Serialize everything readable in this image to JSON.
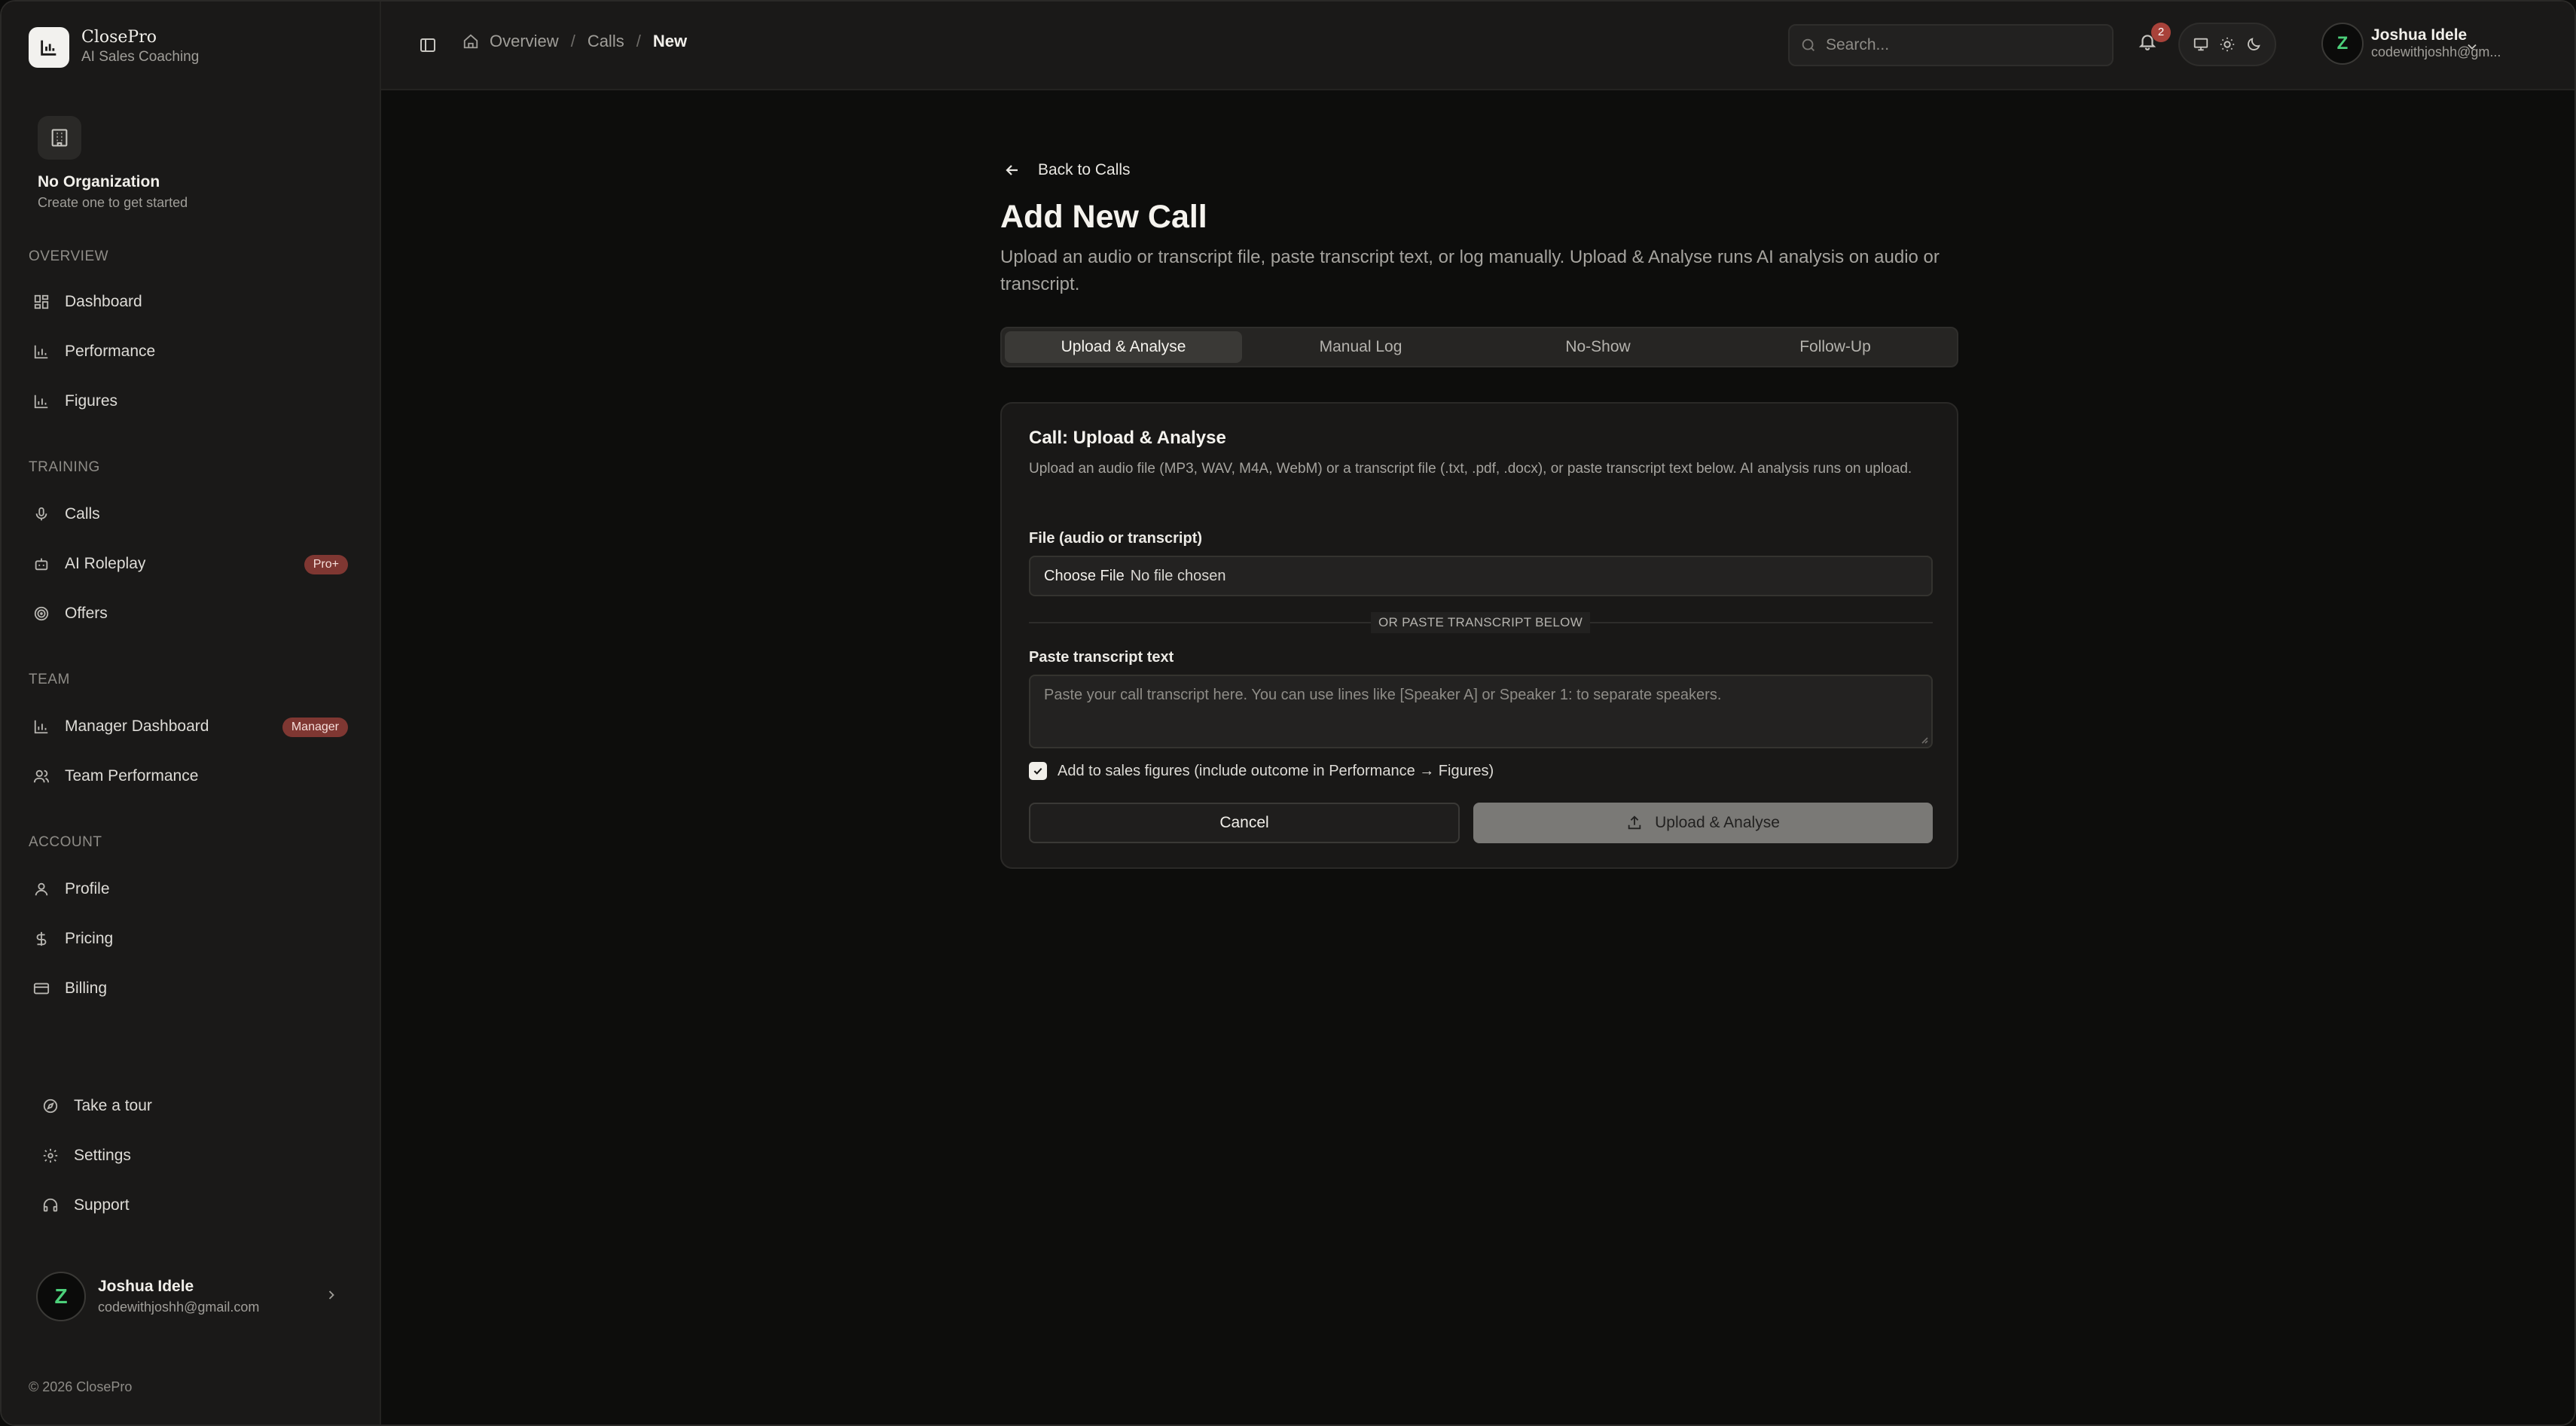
{
  "brand": {
    "name": "ClosePro",
    "subtitle": "AI Sales Coaching"
  },
  "organization": {
    "title": "No Organization",
    "subtitle": "Create one to get started"
  },
  "sidebar": {
    "sections": [
      {
        "label": "OVERVIEW",
        "items": [
          {
            "label": "Dashboard",
            "icon": "dashboard-icon"
          },
          {
            "label": "Performance",
            "icon": "bar-chart-icon"
          },
          {
            "label": "Figures",
            "icon": "bar-chart-icon"
          }
        ]
      },
      {
        "label": "TRAINING",
        "items": [
          {
            "label": "Calls",
            "icon": "microphone-icon"
          },
          {
            "label": "AI Roleplay",
            "icon": "bot-icon",
            "badge": "Pro+"
          },
          {
            "label": "Offers",
            "icon": "target-icon"
          }
        ]
      },
      {
        "label": "TEAM",
        "items": [
          {
            "label": "Manager Dashboard",
            "icon": "bar-chart-icon",
            "badge": "Manager"
          },
          {
            "label": "Team Performance",
            "icon": "users-icon"
          }
        ]
      },
      {
        "label": "ACCOUNT",
        "items": [
          {
            "label": "Profile",
            "icon": "user-icon"
          },
          {
            "label": "Pricing",
            "icon": "dollar-icon"
          },
          {
            "label": "Billing",
            "icon": "credit-card-icon"
          }
        ]
      }
    ],
    "footer_items": [
      {
        "label": "Take a tour",
        "icon": "compass-icon"
      },
      {
        "label": "Settings",
        "icon": "gear-icon"
      },
      {
        "label": "Support",
        "icon": "headset-icon"
      }
    ],
    "user": {
      "initial": "Z",
      "name": "Joshua Idele",
      "email": "codewithjoshh@gmail.com"
    },
    "copyright": "© 2026 ClosePro"
  },
  "header": {
    "breadcrumbs": [
      "Overview",
      "Calls",
      "New"
    ],
    "search_placeholder": "Search...",
    "notification_count": "2",
    "user": {
      "initial": "Z",
      "name": "Joshua Idele",
      "email": "codewithjoshh@gm..."
    }
  },
  "main": {
    "back_label": "Back to Calls",
    "title": "Add New Call",
    "description": "Upload an audio or transcript file, paste transcript text, or log manually. Upload & Analyse runs AI analysis on audio or transcript.",
    "tabs": [
      "Upload & Analyse",
      "Manual Log",
      "No-Show",
      "Follow-Up"
    ],
    "active_tab": "Upload & Analyse",
    "card": {
      "title": "Call: Upload & Analyse",
      "description": "Upload an audio file (MP3, WAV, M4A, WebM) or a transcript file (.txt, .pdf, .docx), or paste transcript text below. AI analysis runs on upload.",
      "file_label": "File (audio or transcript)",
      "file_button": "Choose File",
      "file_value": "No file chosen",
      "divider_text": "OR PASTE TRANSCRIPT BELOW",
      "transcript_label": "Paste transcript text",
      "transcript_placeholder": "Paste your call transcript here. You can use lines like [Speaker A] or Speaker 1: to separate speakers.",
      "checkbox_label": "Add to sales figures (include outcome in Performance → Figures)",
      "checkbox_checked": true,
      "cancel_label": "Cancel",
      "upload_label": "Upload & Analyse"
    }
  }
}
